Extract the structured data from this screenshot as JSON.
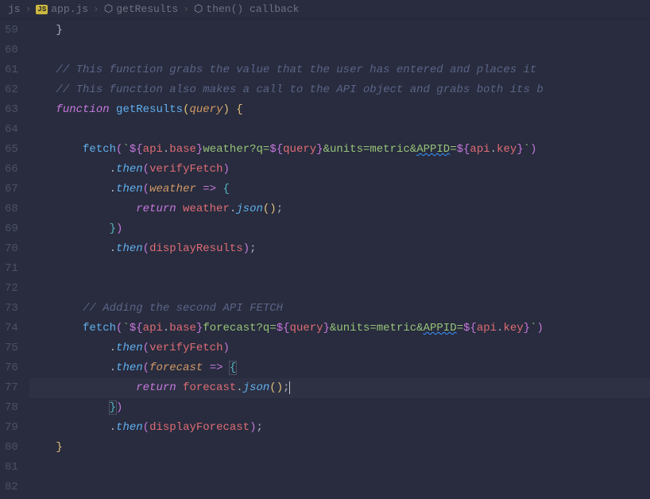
{
  "breadcrumb": {
    "items": [
      {
        "label": "js",
        "icon": null
      },
      {
        "label": "app.js",
        "icon": "JS"
      },
      {
        "label": "getResults",
        "icon": "cube"
      },
      {
        "label": "then() callback",
        "icon": "cube"
      }
    ]
  },
  "gutter": {
    "start": 59,
    "end": 82
  },
  "code": {
    "lines": [
      {
        "n": 59,
        "indent": 1,
        "tokens": [
          {
            "t": "}",
            "c": "punc"
          }
        ]
      },
      {
        "n": 60,
        "indent": 0,
        "tokens": []
      },
      {
        "n": 61,
        "indent": 1,
        "tokens": [
          {
            "t": "// This function grabs the value that the user has entered and places it ",
            "c": "comment"
          }
        ]
      },
      {
        "n": 62,
        "indent": 1,
        "tokens": [
          {
            "t": "// This function also makes a call to the API object and grabs both its b",
            "c": "comment"
          }
        ]
      },
      {
        "n": 63,
        "indent": 1,
        "tokens": [
          {
            "t": "function ",
            "c": "keyword"
          },
          {
            "t": "getResults",
            "c": "func"
          },
          {
            "t": "(",
            "c": "punc-gold"
          },
          {
            "t": "query",
            "c": "param"
          },
          {
            "t": ")",
            "c": "punc-gold"
          },
          {
            "t": " ",
            "c": "punc"
          },
          {
            "t": "{",
            "c": "punc-gold"
          }
        ]
      },
      {
        "n": 64,
        "indent": 0,
        "tokens": []
      },
      {
        "n": 65,
        "indent": 2,
        "tokens": [
          {
            "t": "fetch",
            "c": "func"
          },
          {
            "t": "(",
            "c": "punc-pink"
          },
          {
            "t": "`",
            "c": "string"
          },
          {
            "t": "${",
            "c": "interp"
          },
          {
            "t": "api",
            "c": "var"
          },
          {
            "t": ".",
            "c": "punc"
          },
          {
            "t": "base",
            "c": "prop"
          },
          {
            "t": "}",
            "c": "interp"
          },
          {
            "t": "weather?q=",
            "c": "string"
          },
          {
            "t": "${",
            "c": "interp"
          },
          {
            "t": "query",
            "c": "var"
          },
          {
            "t": "}",
            "c": "interp"
          },
          {
            "t": "&units=metric&",
            "c": "string"
          },
          {
            "t": "APPID",
            "c": "string",
            "squiggle": true
          },
          {
            "t": "=",
            "c": "string"
          },
          {
            "t": "${",
            "c": "interp"
          },
          {
            "t": "api",
            "c": "var"
          },
          {
            "t": ".",
            "c": "punc"
          },
          {
            "t": "key",
            "c": "prop"
          },
          {
            "t": "}",
            "c": "interp"
          },
          {
            "t": "`",
            "c": "string"
          },
          {
            "t": ")",
            "c": "punc-pink"
          }
        ]
      },
      {
        "n": 66,
        "indent": 3,
        "tokens": [
          {
            "t": ".",
            "c": "punc"
          },
          {
            "t": "then",
            "c": "method"
          },
          {
            "t": "(",
            "c": "punc-pink"
          },
          {
            "t": "verifyFetch",
            "c": "var"
          },
          {
            "t": ")",
            "c": "punc-pink"
          }
        ]
      },
      {
        "n": 67,
        "indent": 3,
        "tokens": [
          {
            "t": ".",
            "c": "punc"
          },
          {
            "t": "then",
            "c": "method"
          },
          {
            "t": "(",
            "c": "punc-pink"
          },
          {
            "t": "weather",
            "c": "param"
          },
          {
            "t": " ",
            "c": "punc"
          },
          {
            "t": "=>",
            "c": "arrow"
          },
          {
            "t": " ",
            "c": "punc"
          },
          {
            "t": "{",
            "c": "punc-blue"
          }
        ]
      },
      {
        "n": 68,
        "indent": 4,
        "tokens": [
          {
            "t": "return ",
            "c": "return"
          },
          {
            "t": "weather",
            "c": "var"
          },
          {
            "t": ".",
            "c": "punc"
          },
          {
            "t": "json",
            "c": "method"
          },
          {
            "t": "(",
            "c": "punc-gold"
          },
          {
            "t": ")",
            "c": "punc-gold"
          },
          {
            "t": ";",
            "c": "punc"
          }
        ]
      },
      {
        "n": 69,
        "indent": 3,
        "tokens": [
          {
            "t": "}",
            "c": "punc-blue"
          },
          {
            "t": ")",
            "c": "punc-pink"
          }
        ]
      },
      {
        "n": 70,
        "indent": 3,
        "tokens": [
          {
            "t": ".",
            "c": "punc"
          },
          {
            "t": "then",
            "c": "method"
          },
          {
            "t": "(",
            "c": "punc-pink"
          },
          {
            "t": "displayResults",
            "c": "var"
          },
          {
            "t": ")",
            "c": "punc-pink"
          },
          {
            "t": ";",
            "c": "punc"
          }
        ]
      },
      {
        "n": 71,
        "indent": 0,
        "tokens": []
      },
      {
        "n": 72,
        "indent": 0,
        "tokens": []
      },
      {
        "n": 73,
        "indent": 2,
        "tokens": [
          {
            "t": "// Adding the second API FETCH",
            "c": "comment"
          }
        ]
      },
      {
        "n": 74,
        "indent": 2,
        "tokens": [
          {
            "t": "fetch",
            "c": "func"
          },
          {
            "t": "(",
            "c": "punc-pink"
          },
          {
            "t": "`",
            "c": "string"
          },
          {
            "t": "${",
            "c": "interp"
          },
          {
            "t": "api",
            "c": "var"
          },
          {
            "t": ".",
            "c": "punc"
          },
          {
            "t": "base",
            "c": "prop"
          },
          {
            "t": "}",
            "c": "interp"
          },
          {
            "t": "forecast?q=",
            "c": "string"
          },
          {
            "t": "${",
            "c": "interp"
          },
          {
            "t": "query",
            "c": "var"
          },
          {
            "t": "}",
            "c": "interp"
          },
          {
            "t": "&units=metric&",
            "c": "string"
          },
          {
            "t": "APPID",
            "c": "string",
            "squiggle": true
          },
          {
            "t": "=",
            "c": "string"
          },
          {
            "t": "${",
            "c": "interp"
          },
          {
            "t": "api",
            "c": "var"
          },
          {
            "t": ".",
            "c": "punc"
          },
          {
            "t": "key",
            "c": "prop"
          },
          {
            "t": "}",
            "c": "interp"
          },
          {
            "t": "`",
            "c": "string"
          },
          {
            "t": ")",
            "c": "punc-pink"
          }
        ]
      },
      {
        "n": 75,
        "indent": 3,
        "tokens": [
          {
            "t": ".",
            "c": "punc"
          },
          {
            "t": "then",
            "c": "method"
          },
          {
            "t": "(",
            "c": "punc-pink"
          },
          {
            "t": "verifyFetch",
            "c": "var"
          },
          {
            "t": ")",
            "c": "punc-pink"
          }
        ]
      },
      {
        "n": 76,
        "indent": 3,
        "tokens": [
          {
            "t": ".",
            "c": "punc"
          },
          {
            "t": "then",
            "c": "method"
          },
          {
            "t": "(",
            "c": "punc-pink"
          },
          {
            "t": "forecast",
            "c": "param"
          },
          {
            "t": " ",
            "c": "punc"
          },
          {
            "t": "=>",
            "c": "arrow"
          },
          {
            "t": " ",
            "c": "punc"
          },
          {
            "t": "{",
            "c": "punc-blue",
            "box": true
          }
        ]
      },
      {
        "n": 77,
        "indent": 4,
        "highlight": true,
        "tokens": [
          {
            "t": "return ",
            "c": "return"
          },
          {
            "t": "forecast",
            "c": "var"
          },
          {
            "t": ".",
            "c": "punc"
          },
          {
            "t": "json",
            "c": "method"
          },
          {
            "t": "(",
            "c": "punc-gold"
          },
          {
            "t": ")",
            "c": "punc-gold"
          },
          {
            "t": ";",
            "c": "punc"
          },
          {
            "t": "",
            "c": "cursor"
          }
        ]
      },
      {
        "n": 78,
        "indent": 3,
        "tokens": [
          {
            "t": "}",
            "c": "punc-blue",
            "box": true
          },
          {
            "t": ")",
            "c": "punc-pink"
          }
        ]
      },
      {
        "n": 79,
        "indent": 3,
        "tokens": [
          {
            "t": ".",
            "c": "punc"
          },
          {
            "t": "then",
            "c": "method"
          },
          {
            "t": "(",
            "c": "punc-pink"
          },
          {
            "t": "displayForecast",
            "c": "var"
          },
          {
            "t": ")",
            "c": "punc-pink"
          },
          {
            "t": ";",
            "c": "punc"
          }
        ]
      },
      {
        "n": 80,
        "indent": 1,
        "tokens": [
          {
            "t": "}",
            "c": "punc-gold"
          }
        ]
      },
      {
        "n": 81,
        "indent": 0,
        "tokens": []
      }
    ]
  },
  "indentSize": 4
}
